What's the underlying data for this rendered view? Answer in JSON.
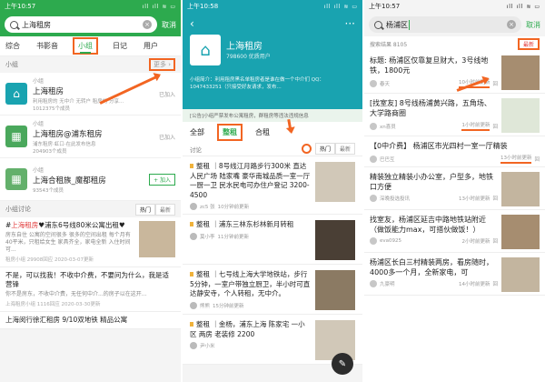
{
  "status": {
    "time1": "上午10:57",
    "time2": "上午10:58",
    "time3": "上午10:57",
    "signal": "ıll ıll ≋ ▭"
  },
  "p1": {
    "search_value": "上海租房",
    "cancel": "取消",
    "tabs": [
      "综合",
      "书影音",
      "小组",
      "日记",
      "用户"
    ],
    "group_section": "小组",
    "more": "更多 ›",
    "groups": [
      {
        "type": "小组",
        "name": "上海租房",
        "desc": "利用租房的 无中介 无转户 租房的 分享...",
        "members": "1012375个成员",
        "status": "已加入"
      },
      {
        "type": "小组",
        "name": "上海租房@浦东租房",
        "desc": "浦东租房·虹口·在此发布信息",
        "members": "204903个成员",
        "status": "已加入"
      },
      {
        "type": "小组",
        "name": "上海合租族_魔都租房",
        "desc": "",
        "members": "93543个成员",
        "status": "+ 加入"
      }
    ],
    "disc_section": "小组讨论",
    "pill": [
      "热门",
      "最新"
    ],
    "posts": [
      {
        "pre": "#",
        "hl": "上海租房",
        "post": "♥浦东6号线80米公寓出租♥",
        "desc": "房东自住 公寓的空间很多 很多的空间出租 每个月有40平米，只租给女生 家具齐全，家电全新 入住时间可...",
        "meta": "租房小组 29908回应 2020-03-07更新"
      },
      {
        "pre": "",
        "hl": "",
        "post": "不是，可以找我！不收中介费，不要问为什么，我是适营锋",
        "desc": "你不是房东，不收中介费，无任何中介...的房子以在这开...",
        "meta": "上海租房小组 1116回应 2020-03-30更新"
      },
      {
        "pre": "",
        "hl": "",
        "post": "上海闵行徐汇租房 9/10双地铁 精品公寓",
        "desc": "",
        "meta": ""
      }
    ]
  },
  "p2": {
    "back": "‹",
    "menu": "···",
    "group_name": "上海租房",
    "group_count": "798600 优质用户",
    "intro": "小组简介：利用租房黑名单租房者是谁在做一个中介们 QQ：1047433251（只接受好友请求，发布...",
    "notice": "[公告]小组严禁发布公寓租房，群租房等违法违规信息",
    "tabs": [
      "全部",
      "整租",
      "合租"
    ],
    "sub_left": "讨论",
    "pill": [
      "热门",
      "最新"
    ],
    "posts": [
      {
        "title": "整租 ｜8号线江月路步行300米 直达人民广场 陆家嘴 豪华南城品质一室一厅一厨一卫 民水民电可办住户登记 3200-4500",
        "author": "zc5 张",
        "time": "10分钟前更新"
      },
      {
        "title": "整租 ｜浦东三林东杉林新月转租",
        "author": "莫小李",
        "time": "11分钟前更新"
      },
      {
        "title": "整租 ｜七号线上海大学地铁站，步行5分钟，一室户带独立厨卫，半小时可直达静安寺，个人转租，无中介。",
        "author": "熊熊",
        "time": "15分钟前更新"
      },
      {
        "title": "整租 ｜金杨，浦东上海 陈家宅 一小区 两房 老装修 2200",
        "author": "尹小米",
        "time": ""
      }
    ]
  },
  "p3": {
    "search_value": "杨浦区",
    "cancel": "取消",
    "results": "搜索结果 8105",
    "latest": "最新",
    "posts": [
      {
        "title": "标题: 杨浦区仅靠复旦财大，3号线地铁，1800元",
        "author": "春天",
        "time": "10小时前更新",
        "replies": "回"
      },
      {
        "title": "[找室友] 8号线杨浦黄兴路，五角场、大学路商圈",
        "author": "xn喜员",
        "time": "1小时前更新",
        "replies": "回"
      },
      {
        "title": "【0中介费】 杨浦区市光四村一室一厅精装",
        "author": "巴巴互",
        "time": "13小时前更新",
        "replies": "回"
      },
      {
        "title": "精装独立精装小办公室，户型多，地铁口方便",
        "author": "深晚投选投讯",
        "time": "13小时前更新",
        "replies": "回"
      },
      {
        "title": "找室友，杨浦区延吉中路地铁站附近（做饭能力max，可搭伙做饭！）",
        "author": "eva0925",
        "time": "2小时前更新",
        "replies": "回"
      },
      {
        "title": "杨浦区长白三村精装两房，看房随时，4000多一个月，全新家电，可",
        "author": "九豪明",
        "time": "14小时前更新",
        "replies": "回"
      }
    ]
  }
}
